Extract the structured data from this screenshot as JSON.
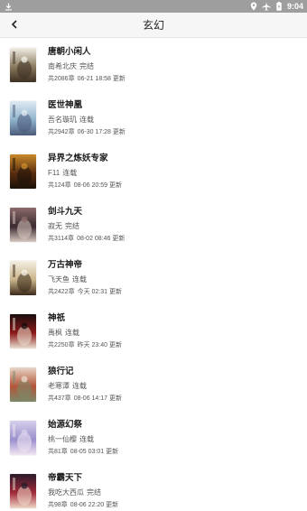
{
  "status_bar": {
    "time": "9:04",
    "icons": [
      "download-icon",
      "location-icon",
      "airplane-mode-icon",
      "battery-icon"
    ]
  },
  "app_bar": {
    "title": "玄幻",
    "back_icon": "back-arrow-icon"
  },
  "books": [
    {
      "title": "唐朝小闲人",
      "author": "南希北庆",
      "status": "完结",
      "chapters": "共2086章",
      "updated": "06-21 18:58 更新",
      "cover_colors": [
        "#f2efe6",
        "#8a7a5e",
        "#3d2f22"
      ]
    },
    {
      "title": "医世神凰",
      "author": "吾名璇玑",
      "status": "连载",
      "chapters": "共2942章",
      "updated": "06-30 17:28 更新",
      "cover_colors": [
        "#dfeaf2",
        "#8fb3cc",
        "#4a5a7a"
      ]
    },
    {
      "title": "异界之炼妖专家",
      "author": "F11",
      "status": "连载",
      "chapters": "共124章",
      "updated": "08-06 20:59 更新",
      "cover_colors": [
        "#c98a2a",
        "#5a2d10",
        "#1a1108"
      ]
    },
    {
      "title": "剑斗九天",
      "author": "寂无",
      "status": "完结",
      "chapters": "共3114章",
      "updated": "08-02 08:46 更新",
      "cover_colors": [
        "#8c6a6a",
        "#3a2a30",
        "#d8c8c0"
      ]
    },
    {
      "title": "万古神帝",
      "author": "飞天鱼",
      "status": "连载",
      "chapters": "共2422章",
      "updated": "今天 02:31 更新",
      "cover_colors": [
        "#f4efe2",
        "#c9b48a",
        "#3b2a1a"
      ]
    },
    {
      "title": "神祇",
      "author": "禹枫",
      "status": "连载",
      "chapters": "共2250章",
      "updated": "昨天 23:40 更新",
      "cover_colors": [
        "#1a0d0d",
        "#8c1a1a",
        "#e9e0d0"
      ]
    },
    {
      "title": "狼行记",
      "author": "老寒潭",
      "status": "连载",
      "chapters": "共437章",
      "updated": "08-06 14:17 更新",
      "cover_colors": [
        "#e8d6c6",
        "#b3553a",
        "#7a8a6a"
      ]
    },
    {
      "title": "始源幻祭",
      "author": "桃一仙樱",
      "status": "连载",
      "chapters": "共81章",
      "updated": "08-05 03:01 更新",
      "cover_colors": [
        "#d6d0ec",
        "#9a8fcc",
        "#f0e6f2"
      ]
    },
    {
      "title": "帝霸天下",
      "author": "我吃大西瓜",
      "status": "完结",
      "chapters": "共98章",
      "updated": "08-06 22:20 更新",
      "cover_colors": [
        "#2a1a2a",
        "#a02a3a",
        "#f0d8c8"
      ]
    }
  ]
}
